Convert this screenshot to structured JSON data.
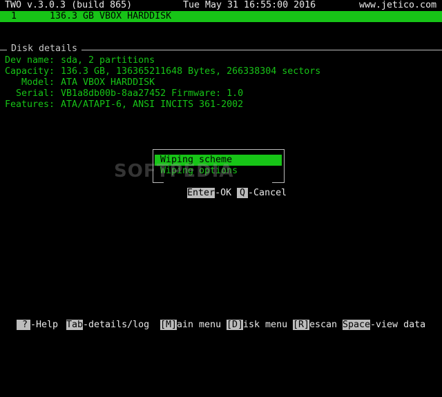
{
  "header": {
    "app_title": "TWO v.3.0.3 (build 865)",
    "datetime": "Tue May 31 16:55:00 2016",
    "website": "www.jetico.com"
  },
  "disk_list": {
    "items": [
      {
        "index": "1",
        "label": "136.3 GB VBOX HARDDISK",
        "selected": true
      }
    ]
  },
  "disk_details": {
    "title": "Disk details",
    "fields": [
      {
        "label": "Dev name:",
        "value": "sda, 2 partitions"
      },
      {
        "label": "Capacity:",
        "value": "136.3 GB, 136365211648 Bytes, 266338304 sectors"
      },
      {
        "label": "Model:",
        "value": "ATA VBOX HARDDISK"
      },
      {
        "label": "Serial:",
        "value": "VB1a8db00b-8aa27452 Firmware: 1.0"
      },
      {
        "label": "Features:",
        "value": "ATA/ATAPI-6, ANSI INCITS 361-2002"
      }
    ]
  },
  "menu_dialog": {
    "items": [
      {
        "label": "Wiping scheme",
        "selected": true
      },
      {
        "label": "Wiping options",
        "selected": false
      }
    ],
    "ok_key": "Enter",
    "ok_label": "-OK",
    "cancel_key": "Q",
    "cancel_label": "-Cancel"
  },
  "footer": {
    "help_key": " ?",
    "help_label": "-Help",
    "tab_key": "Tab",
    "tab_label": "-details/log",
    "main_key": "[M]",
    "main_label": "ain menu",
    "disk_key": "[D]",
    "disk_label": "isk menu",
    "rescan_key": "[R]",
    "rescan_label": "escan",
    "space_key": "Space",
    "space_label": "-view data"
  },
  "watermark": "SOFTPEDIA",
  "colors": {
    "accent_green": "#17c417",
    "key_bg": "#bdbdbd",
    "background": "#000000"
  }
}
